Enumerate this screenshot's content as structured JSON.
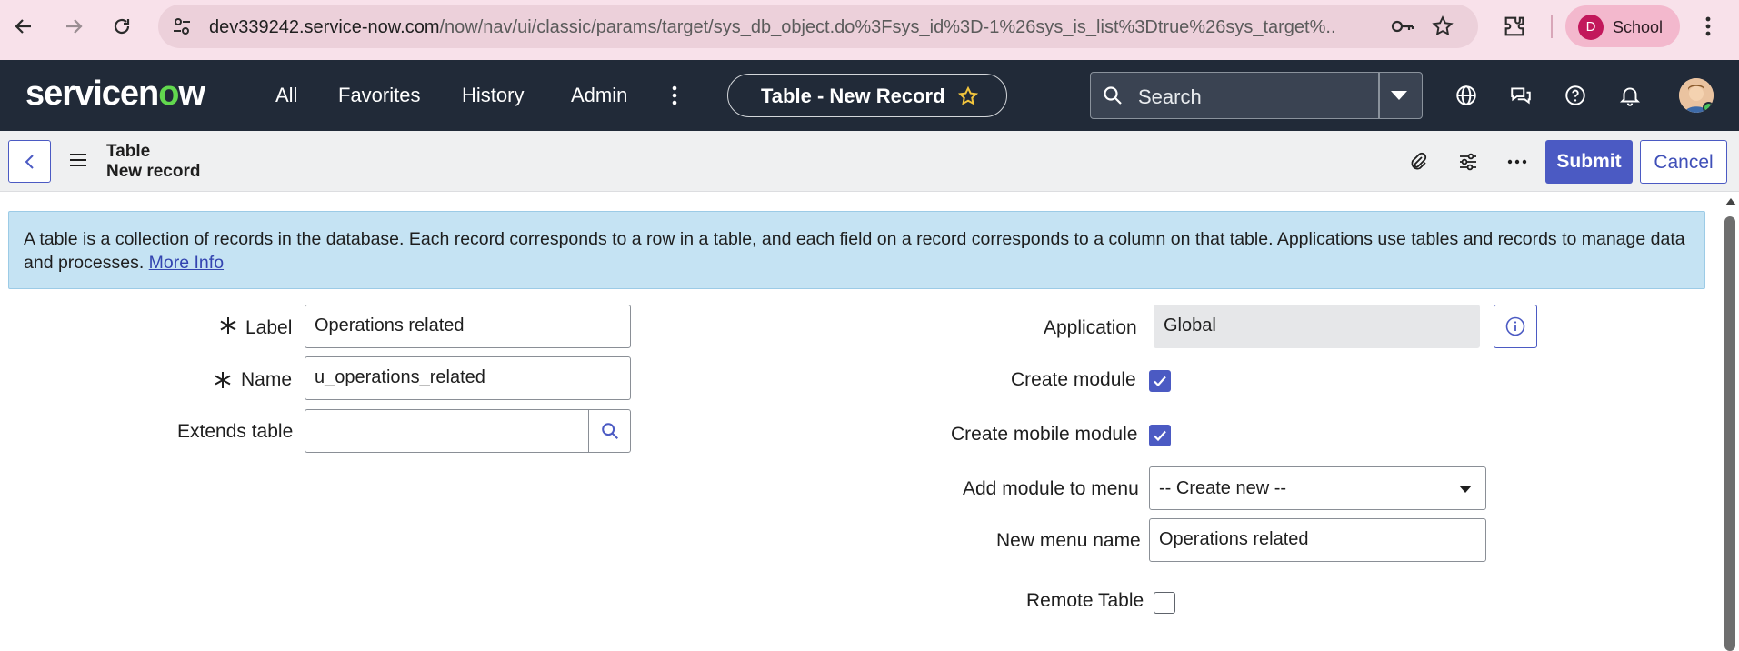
{
  "browser": {
    "url_host": "dev339242.service-now.com",
    "url_rest": "/now/nav/ui/classic/params/target/sys_db_object.do%3Fsys_id%3D-1%26sys_is_list%3Dtrue%26sys_target%...",
    "profile_initial": "D",
    "profile_label": "School"
  },
  "header": {
    "logo_pre": "servicen",
    "logo_o": "o",
    "logo_post": "w",
    "nav": [
      "All",
      "Favorites",
      "History",
      "Admin"
    ],
    "record_title": "Table - New Record",
    "search_placeholder": "Search"
  },
  "form_header": {
    "crumb_title": "Table",
    "crumb_sub": "New record",
    "submit_label": "Submit",
    "cancel_label": "Cancel"
  },
  "info": {
    "text": "A table is a collection of records in the database. Each record corresponds to a row in a table, and each field on a record corresponds to a column on that table. Applications use tables and records to manage data and processes. ",
    "link": "More Info"
  },
  "form": {
    "label_field": {
      "label": "Label",
      "value": "Operations related"
    },
    "name_field": {
      "label": "Name",
      "value": "u_operations_related"
    },
    "extends_field": {
      "label": "Extends table",
      "value": ""
    },
    "application_field": {
      "label": "Application",
      "value": "Global"
    },
    "create_module": {
      "label": "Create module",
      "checked": true
    },
    "create_mobile_module": {
      "label": "Create mobile module",
      "checked": true
    },
    "add_module_to_menu": {
      "label": "Add module to menu",
      "value": "-- Create new --"
    },
    "new_menu_name": {
      "label": "New menu name",
      "value": "Operations related"
    },
    "remote_table": {
      "label": "Remote Table",
      "checked": false
    }
  },
  "colors": {
    "accent": "#4b5ac3",
    "header_bg": "#212a38",
    "info_bg": "#c5e3f3"
  }
}
